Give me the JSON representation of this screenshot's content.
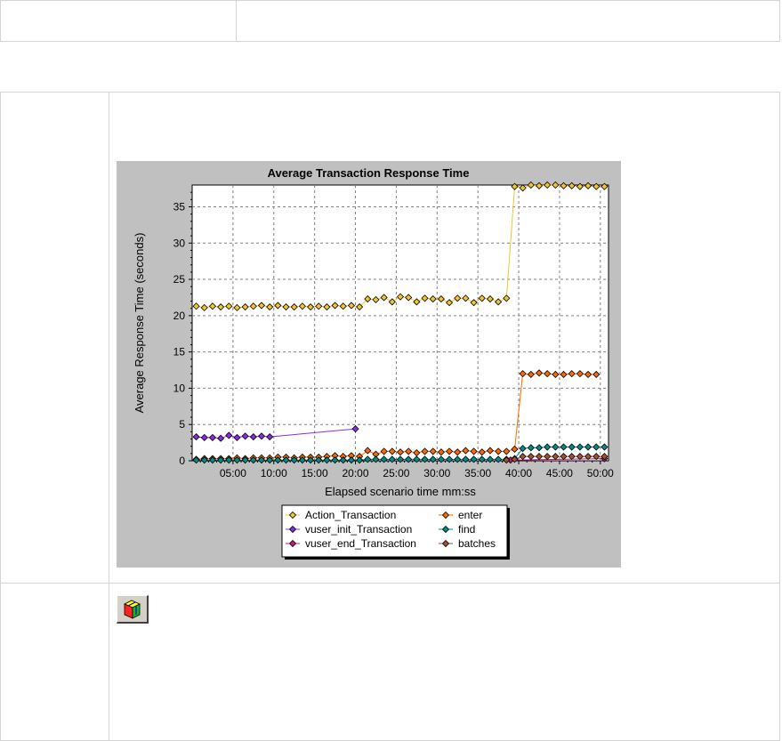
{
  "colors": {
    "chart_background": "#c0c0c0",
    "plot_background": "#ffffff",
    "grid": "#808080"
  },
  "icons": {
    "toolbar_button": "cube-icon"
  },
  "chart_data": {
    "type": "line",
    "title": "Average Transaction Response Time",
    "xlabel": "Elapsed scenario time mm:ss",
    "ylabel": "Average Response Time (seconds)",
    "x_unit": "minutes",
    "xlim": [
      0,
      51
    ],
    "ylim": [
      0,
      38
    ],
    "x_ticks": [
      5,
      10,
      15,
      20,
      25,
      30,
      35,
      40,
      45,
      50
    ],
    "x_tick_labels": [
      "05:00",
      "10:00",
      "15:00",
      "20:00",
      "25:00",
      "30:00",
      "35:00",
      "40:00",
      "45:00",
      "50:00"
    ],
    "y_ticks": [
      0,
      5,
      10,
      15,
      20,
      25,
      30,
      35
    ],
    "grid": true,
    "legend_position": "bottom",
    "series": [
      {
        "name": "Action_Transaction",
        "color": "#f4c430",
        "x": [
          0.5,
          1.5,
          2.5,
          3.5,
          4.5,
          5.5,
          6.5,
          7.5,
          8.5,
          9.5,
          10.5,
          11.5,
          12.5,
          13.5,
          14.5,
          15.5,
          16.5,
          17.5,
          18.5,
          19.5,
          20.5,
          21.5,
          22.5,
          23.5,
          24.5,
          25.5,
          26.5,
          27.5,
          28.5,
          29.5,
          30.5,
          31.5,
          32.5,
          33.5,
          34.5,
          35.5,
          36.5,
          37.5,
          38.5,
          39.5,
          40.5,
          41.5,
          42.5,
          43.5,
          44.5,
          45.5,
          46.5,
          47.5,
          48.5,
          49.5,
          50.5
        ],
        "y": [
          21.3,
          21.1,
          21.3,
          21.2,
          21.3,
          21.1,
          21.2,
          21.3,
          21.4,
          21.2,
          21.4,
          21.2,
          21.2,
          21.3,
          21.2,
          21.3,
          21.2,
          21.4,
          21.3,
          21.4,
          21.2,
          22.3,
          22.2,
          22.5,
          21.9,
          22.6,
          22.5,
          21.9,
          22.4,
          22.3,
          22.3,
          21.8,
          22.4,
          22.4,
          21.8,
          22.4,
          22.3,
          21.9,
          22.4,
          37.8,
          37.6,
          38.0,
          37.9,
          38.0,
          38.0,
          37.9,
          37.9,
          37.8,
          37.9,
          37.8,
          37.8
        ]
      },
      {
        "name": "enter",
        "color": "#ff6a00",
        "x": [
          0.5,
          1.5,
          2.5,
          3.5,
          4.5,
          5.5,
          6.5,
          7.5,
          8.5,
          9.5,
          10.5,
          11.5,
          12.5,
          13.5,
          14.5,
          15.5,
          16.5,
          17.5,
          18.5,
          19.5,
          20.5,
          21.5,
          22.5,
          23.5,
          24.5,
          25.5,
          26.5,
          27.5,
          28.5,
          29.5,
          30.5,
          31.5,
          32.5,
          33.5,
          34.5,
          35.5,
          36.5,
          37.5,
          38.5,
          39.5,
          40.5,
          41.5,
          42.5,
          43.5,
          44.5,
          45.5,
          46.5,
          47.5,
          48.5,
          49.5
        ],
        "y": [
          0.2,
          0.3,
          0.3,
          0.3,
          0.3,
          0.4,
          0.3,
          0.4,
          0.4,
          0.4,
          0.5,
          0.5,
          0.4,
          0.5,
          0.5,
          0.5,
          0.6,
          0.7,
          0.6,
          0.7,
          0.6,
          1.4,
          0.9,
          1.3,
          1.3,
          1.2,
          1.3,
          1.1,
          1.3,
          1.3,
          1.2,
          1.3,
          1.2,
          1.4,
          1.3,
          1.2,
          1.4,
          1.3,
          1.3,
          1.6,
          12.0,
          11.9,
          12.1,
          12.0,
          11.9,
          11.9,
          12.0,
          12.0,
          11.9,
          11.9
        ]
      },
      {
        "name": "vuser_init_Transaction",
        "color": "#8b2be2",
        "x": [
          0.5,
          1.5,
          2.5,
          3.5,
          4.5,
          5.5,
          6.5,
          7.5,
          8.5,
          9.5,
          20.0
        ],
        "y": [
          3.3,
          3.2,
          3.2,
          3.1,
          3.5,
          3.2,
          3.4,
          3.3,
          3.4,
          3.3,
          4.4
        ]
      },
      {
        "name": "find",
        "color": "#008b8b",
        "x": [
          0.5,
          1.5,
          2.5,
          3.5,
          4.5,
          5.5,
          6.5,
          7.5,
          8.5,
          9.5,
          10.5,
          11.5,
          12.5,
          13.5,
          14.5,
          15.5,
          16.5,
          17.5,
          18.5,
          19.5,
          20.5,
          21.5,
          22.5,
          23.5,
          24.5,
          25.5,
          26.5,
          27.5,
          28.5,
          29.5,
          30.5,
          31.5,
          32.5,
          33.5,
          34.5,
          35.5,
          36.5,
          37.5,
          38.5,
          39.5,
          40.5,
          41.5,
          42.5,
          43.5,
          44.5,
          45.5,
          46.5,
          47.5,
          48.5,
          49.5,
          50.5
        ],
        "y": [
          0.1,
          0.1,
          0.1,
          0.1,
          0.1,
          0.1,
          0.1,
          0.1,
          0.1,
          0.1,
          0.1,
          0.1,
          0.1,
          0.1,
          0.1,
          0.1,
          0.1,
          0.1,
          0.1,
          0.1,
          0.1,
          0.2,
          0.2,
          0.2,
          0.2,
          0.2,
          0.2,
          0.2,
          0.2,
          0.2,
          0.2,
          0.2,
          0.2,
          0.2,
          0.2,
          0.2,
          0.2,
          0.2,
          0.2,
          0.3,
          1.7,
          1.8,
          1.8,
          1.9,
          1.9,
          1.9,
          1.9,
          1.9,
          1.9,
          1.9,
          1.9
        ]
      },
      {
        "name": "vuser_end_Transaction",
        "color": "#c71585",
        "x": [
          39.0,
          50.5
        ],
        "y": [
          0.1,
          0.3
        ]
      },
      {
        "name": "batches",
        "color": "#a0522d",
        "x": [
          38.5,
          39.5,
          40.5,
          41.5,
          42.5,
          43.5,
          44.5,
          45.5,
          46.5,
          47.5,
          48.5,
          49.5,
          50.5
        ],
        "y": [
          0.1,
          0.2,
          0.6,
          0.6,
          0.6,
          0.6,
          0.6,
          0.6,
          0.6,
          0.6,
          0.6,
          0.6,
          0.6
        ]
      }
    ]
  }
}
